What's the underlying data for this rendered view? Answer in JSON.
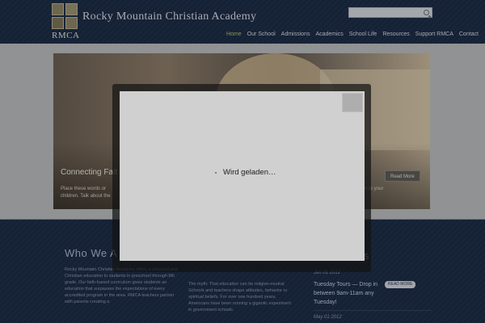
{
  "header": {
    "logo_text": "RMCA",
    "site_title": "Rocky Mountain Christian Academy",
    "search": {
      "placeholder": "",
      "value": ""
    }
  },
  "nav": {
    "items": [
      "Home",
      "Our School",
      "Admissions",
      "Academics",
      "School Life",
      "Resources",
      "Support RMCA",
      "Contact"
    ],
    "active": "Home"
  },
  "slider": {
    "caption_title": "Connecting Fait",
    "caption_text_left": "Place these words or",
    "caption_text_left2": "children. Talk about the",
    "caption_text_right": "them to your",
    "read_more": "Read More"
  },
  "about": {
    "title": "Who We A",
    "text": "Rocky Mountain Christian Academy offers a classical and Christian education to students in preschool through 8th grade. Our faith-based curriculum gives students an education that surpasses the expectations of every accredited program in the area. RMCA teachers partner with parents creating a"
  },
  "middle": {
    "text": "The myth: That education can be religion-neutral. Schools and teachers shape attitudes, behavior or spiritual beliefs. For over one hundred years, Americans have been running a gigantic experiment in government schools"
  },
  "news": {
    "title": "s",
    "items": [
      {
        "date": "Jun 01 2012",
        "headline": "Tuesday Tours — Drop in between 9am-11am any Tuesday!",
        "more": "READ MORE"
      },
      {
        "date": "May 01 2012"
      }
    ]
  },
  "modal": {
    "loading_text": "Wird geladen…"
  }
}
